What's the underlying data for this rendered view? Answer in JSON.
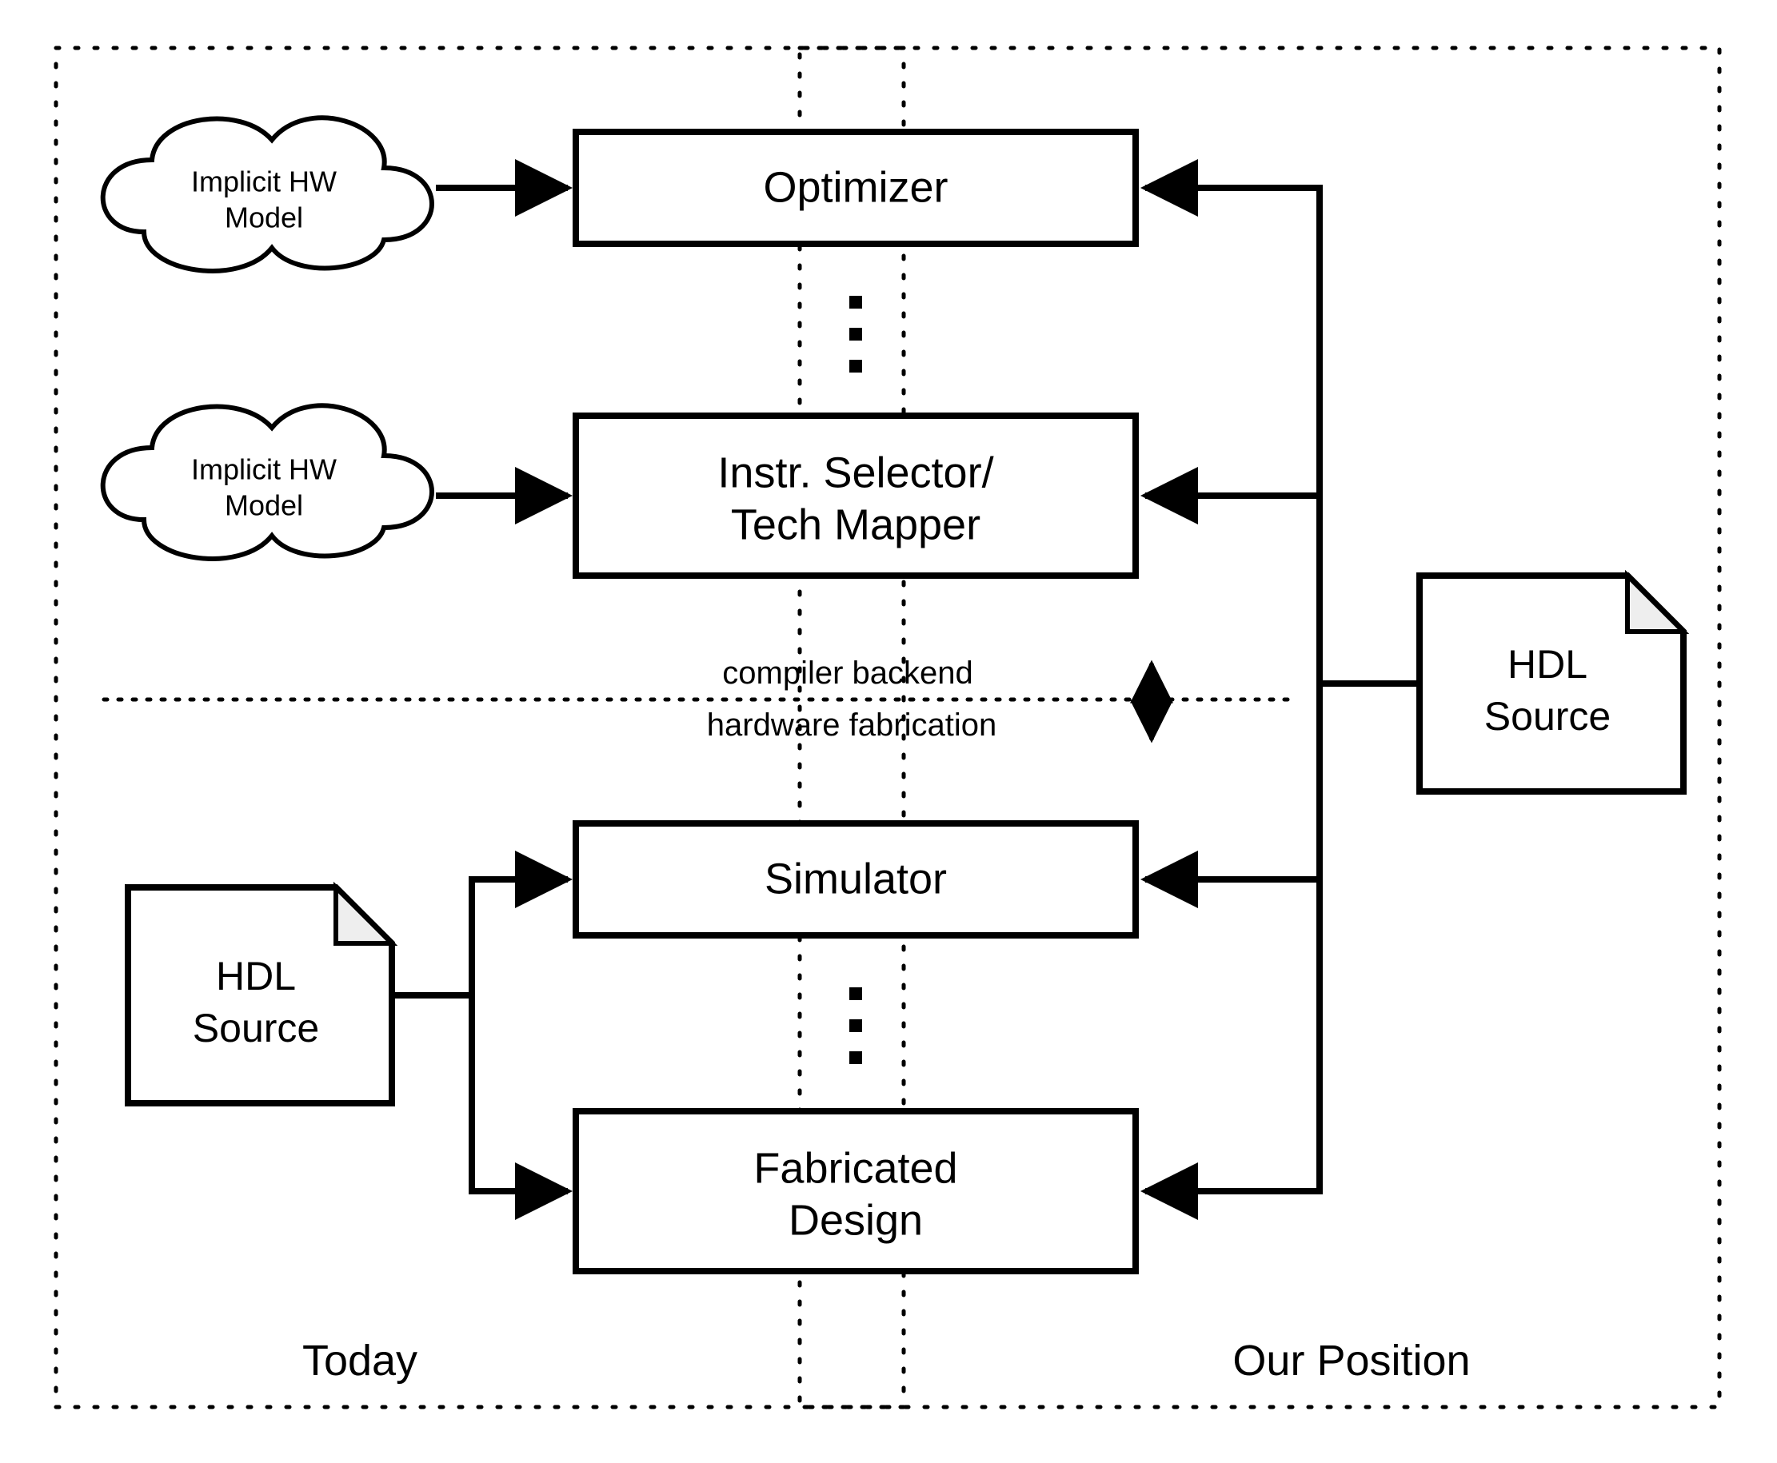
{
  "clouds": {
    "c1": {
      "line1": "Implicit HW",
      "line2": "Model"
    },
    "c2": {
      "line1": "Implicit HW",
      "line2": "Model"
    }
  },
  "boxes": {
    "optimizer": "Optimizer",
    "selector_line1": "Instr. Selector/",
    "selector_line2": "Tech Mapper",
    "simulator": "Simulator",
    "fab_line1": "Fabricated",
    "fab_line2": "Design"
  },
  "docs": {
    "left_line1": "HDL",
    "left_line2": "Source",
    "right_line1": "HDL",
    "right_line2": "Source"
  },
  "separator": {
    "top": "compiler backend",
    "bottom": "hardware fabrication"
  },
  "groups": {
    "left": "Today",
    "right": "Our Position"
  }
}
